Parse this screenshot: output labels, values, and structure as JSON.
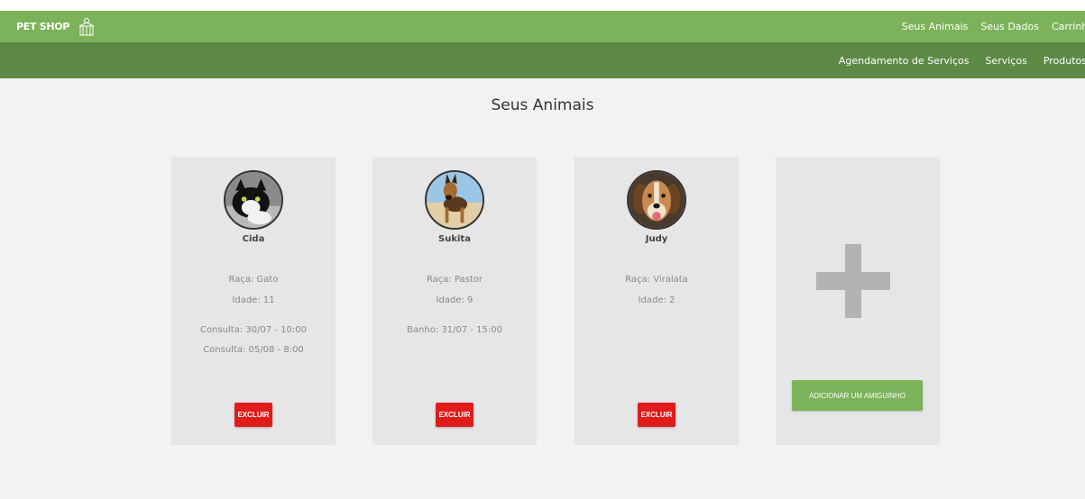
{
  "header": {
    "brand": "PET SHOP",
    "brand_icon": "pet-shop-logo-icon",
    "nav": [
      "Seus Animais",
      "Seus Dados",
      "Carrinho"
    ],
    "accent_color": "#7cb259"
  },
  "subheader": {
    "nav": [
      "Agendamento de Serviços",
      "Serviços",
      "Produtos"
    ],
    "color": "#5c8a44"
  },
  "main": {
    "title": "Seus Animais",
    "pets": [
      {
        "name": "Cida",
        "breed": "Raça: Gato",
        "age": "Idade: 11",
        "appointments": [
          "Consulta: 30/07 - 10:00",
          "Consulta: 05/08 - 8:00"
        ],
        "delete_label": "EXCLUIR"
      },
      {
        "name": "Sukita",
        "breed": "Raça: Pastor",
        "age": "Idade: 9",
        "appointments": [
          "Banho: 31/07 - 15:00"
        ],
        "delete_label": "EXCLUIR"
      },
      {
        "name": "Judy",
        "breed": "Raça: Viralata",
        "age": "Idade: 2",
        "appointments": [],
        "delete_label": "EXCLUIR"
      }
    ],
    "add_card": {
      "icon": "plus-icon",
      "button_label": "ADICIONAR UM AMIGUINHO"
    },
    "delete_color": "#e01b1b"
  }
}
